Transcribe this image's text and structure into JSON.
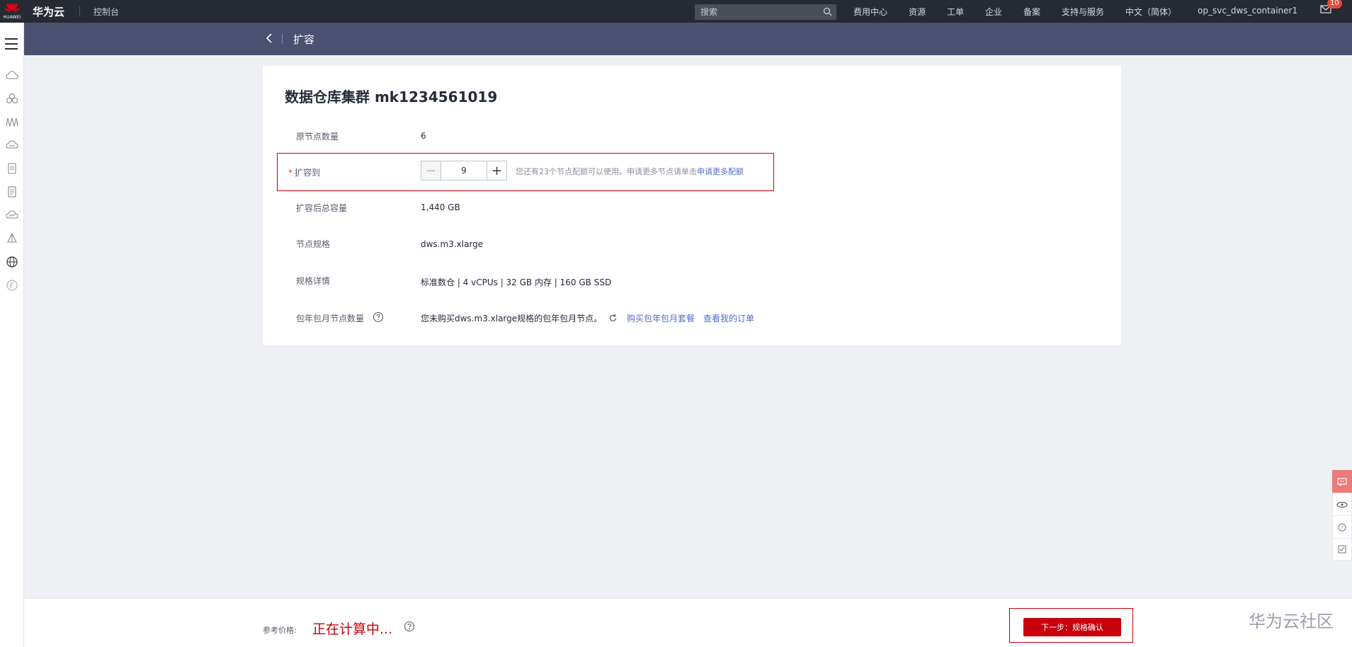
{
  "topbar": {
    "logo_text": "HUAWEI",
    "brand": "华为云",
    "console": "控制台",
    "search_placeholder": "搜索",
    "nav": [
      "费用中心",
      "资源",
      "工单",
      "企业",
      "备案",
      "支持与服务",
      "中文（简体）",
      "op_svc_dws_container1"
    ],
    "mail_badge": "10"
  },
  "subheader": {
    "title": "扩容"
  },
  "card": {
    "title": "数据仓库集群 mk1234561019",
    "rows": {
      "original_nodes": {
        "label": "原节点数量",
        "value": "6"
      },
      "expand_to": {
        "label": "扩容到",
        "required": "*",
        "value": "9",
        "hint_prefix": "您还有23个节点配额可以使用。申请更多节点请单击",
        "hint_link": "申请更多配额"
      },
      "total_capacity": {
        "label": "扩容后总容量",
        "value": "1,440 GB"
      },
      "node_flavor": {
        "label": "节点规格",
        "value": "dws.m3.xlarge"
      },
      "flavor_detail": {
        "label": "规格详情",
        "value": "标准数仓 | 4 vCPUs | 32 GB 内存 | 160 GB SSD"
      },
      "monthly_nodes": {
        "label": "包年包月节点数量",
        "value": "您未购买dws.m3.xlarge规格的包年包月节点。",
        "link_buy": "购买包年包月套餐",
        "link_orders": "查看我的订单"
      }
    }
  },
  "bottombar": {
    "price_label": "参考价格:",
    "price_value": "正在计算中...",
    "next_button": "下一步：规格确认"
  },
  "watermark": "华为云社区",
  "colors": {
    "topbar": "#262a33",
    "subheader": "#4c5070",
    "accent_red": "#c7000b",
    "link": "#526ecc"
  }
}
